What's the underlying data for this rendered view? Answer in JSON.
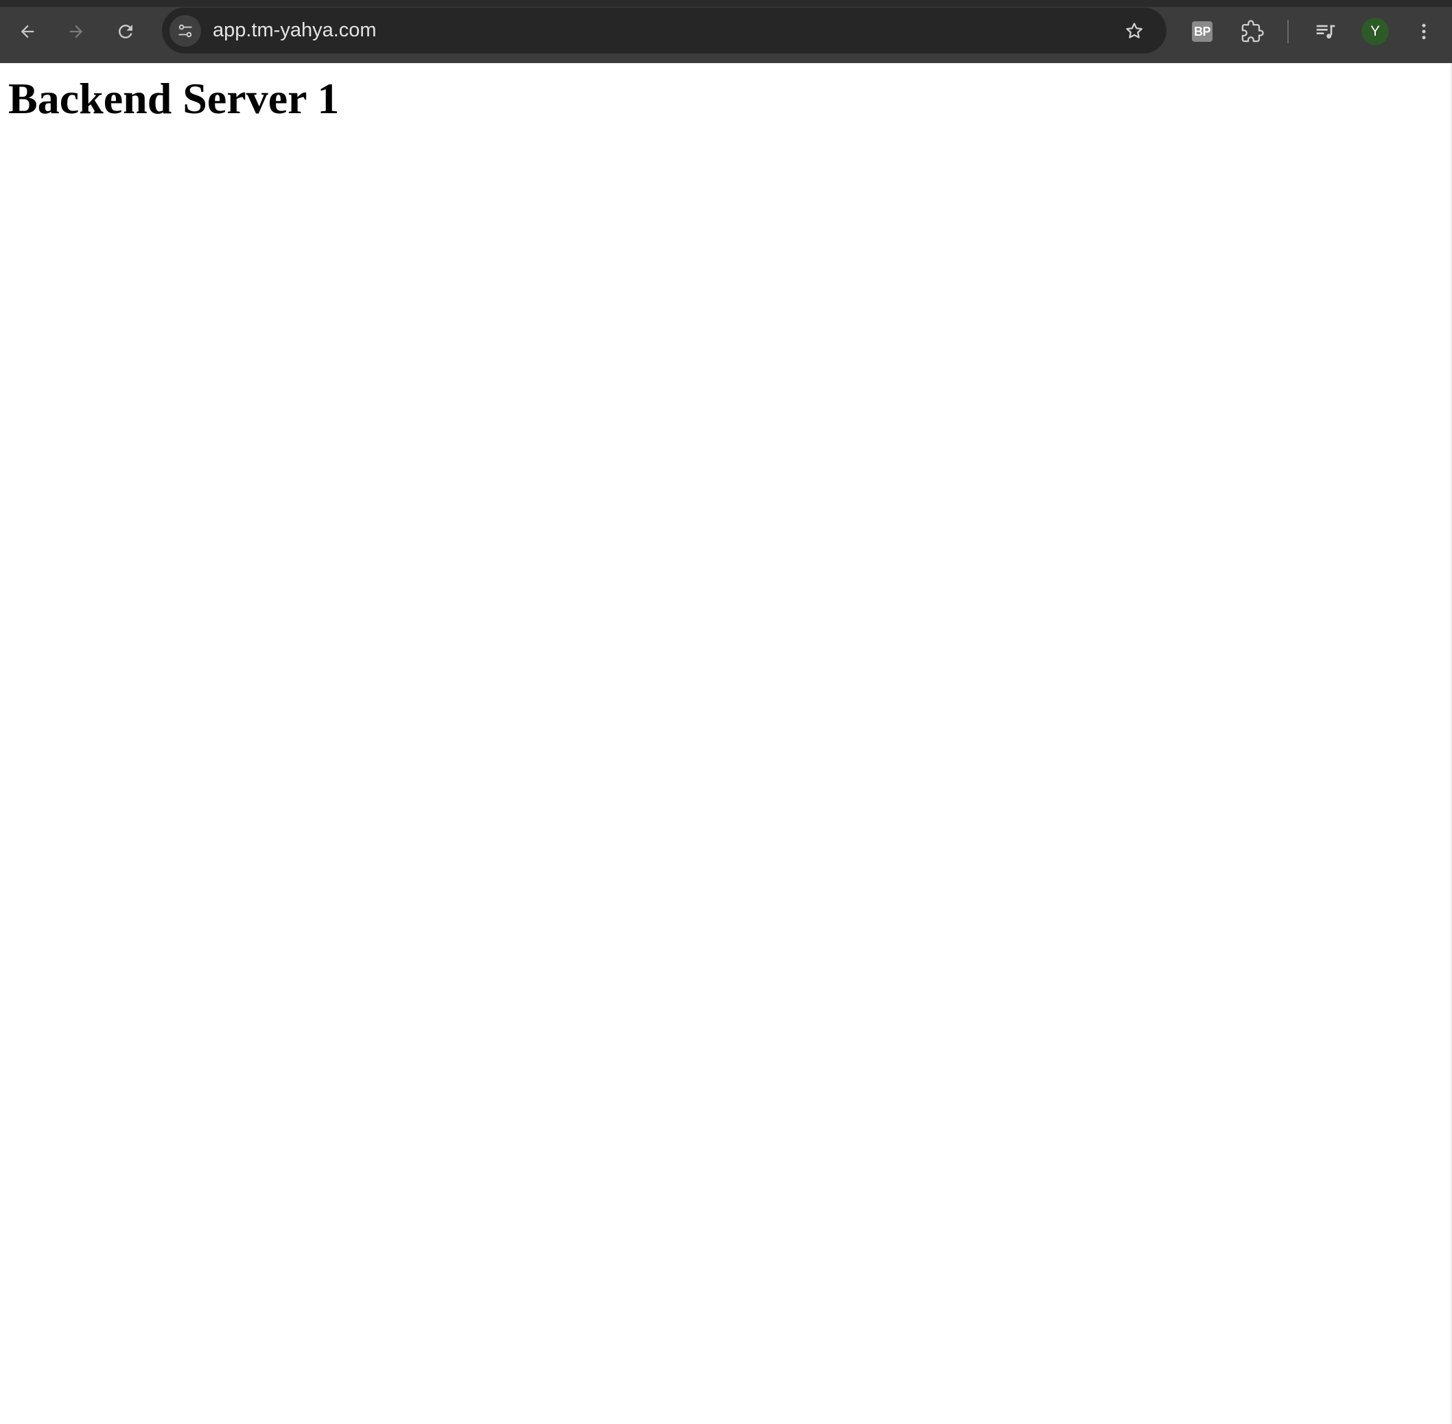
{
  "browser": {
    "url": "app.tm-yahya.com",
    "extension_badge": "BP",
    "profile_initial": "Y",
    "icons": {
      "back": "back-arrow-icon",
      "forward": "forward-arrow-icon",
      "reload": "reload-icon",
      "site_info": "tune-icon",
      "bookmark": "star-icon",
      "extensions": "puzzle-icon",
      "media": "queue-music-icon",
      "menu": "kebab-menu-icon"
    },
    "colors": {
      "toolbar": "#3c3c3c",
      "omnibox": "#262626",
      "avatar": "#2d5a27"
    }
  },
  "page": {
    "heading": "Backend Server 1"
  }
}
